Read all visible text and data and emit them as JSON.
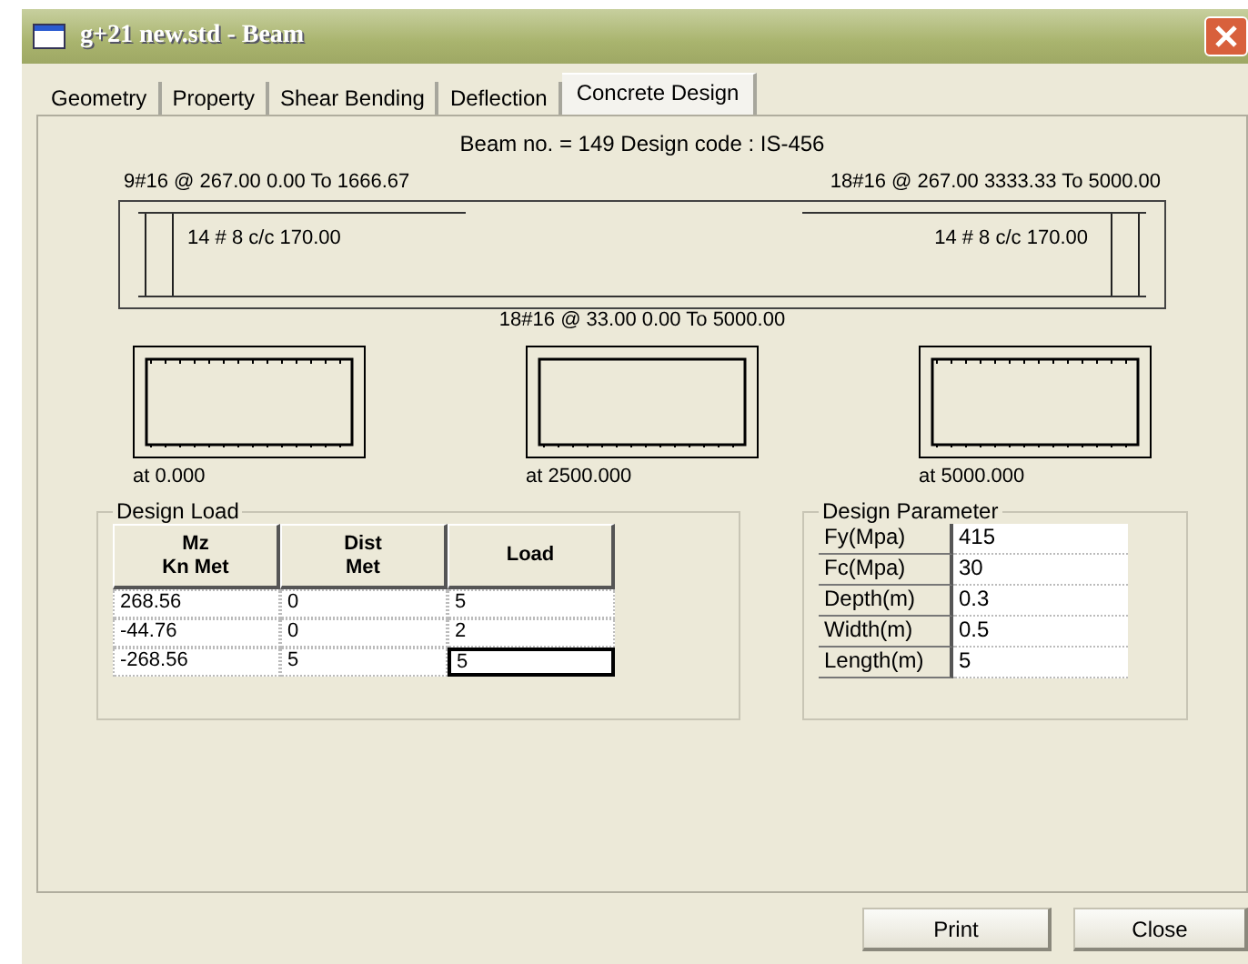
{
  "window": {
    "title": "g+21 new.std - Beam"
  },
  "tabs": [
    {
      "label": "Geometry",
      "selected": false
    },
    {
      "label": "Property",
      "selected": false
    },
    {
      "label": "Shear Bending",
      "selected": false
    },
    {
      "label": "Deflection",
      "selected": false
    },
    {
      "label": "Concrete Design",
      "selected": true
    }
  ],
  "heading": "Beam no. = 149  Design code :  IS-456",
  "beam": {
    "top_left": "9#16 @ 267.00 0.00 To 1666.67",
    "top_right": "18#16 @ 267.00 3333.33 To 5000.00",
    "stirrup_left": "14 # 8 c/c 170.00",
    "stirrup_right": "14 # 8 c/c 170.00",
    "bottom": "18#16 @ 33.00 0.00 To 5000.00"
  },
  "sections": [
    {
      "label": "at 0.000"
    },
    {
      "label": "at 2500.000"
    },
    {
      "label": "at 5000.000"
    }
  ],
  "design_load": {
    "title": "Design Load",
    "columns": [
      "Mz\nKn Met",
      "Dist\nMet",
      "Load"
    ],
    "rows": [
      [
        {
          "text": "268.56",
          "selected": false
        },
        {
          "text": "0",
          "selected": false
        },
        {
          "text": "5",
          "selected": false
        }
      ],
      [
        {
          "text": "-44.76",
          "selected": false
        },
        {
          "text": "0",
          "selected": false
        },
        {
          "text": "2",
          "selected": false
        }
      ],
      [
        {
          "text": "-268.56",
          "selected": false
        },
        {
          "text": "5",
          "selected": false
        },
        {
          "text": "5",
          "selected": true
        }
      ]
    ]
  },
  "design_parameter": {
    "title": "Design Parameter",
    "rows": [
      {
        "label": "Fy(Mpa)",
        "value": "415"
      },
      {
        "label": "Fc(Mpa)",
        "value": "30"
      },
      {
        "label": "Depth(m)",
        "value": "0.3"
      },
      {
        "label": "Width(m)",
        "value": "0.5"
      },
      {
        "label": "Length(m)",
        "value": "5"
      }
    ]
  },
  "buttons": [
    "Print",
    "Close"
  ]
}
